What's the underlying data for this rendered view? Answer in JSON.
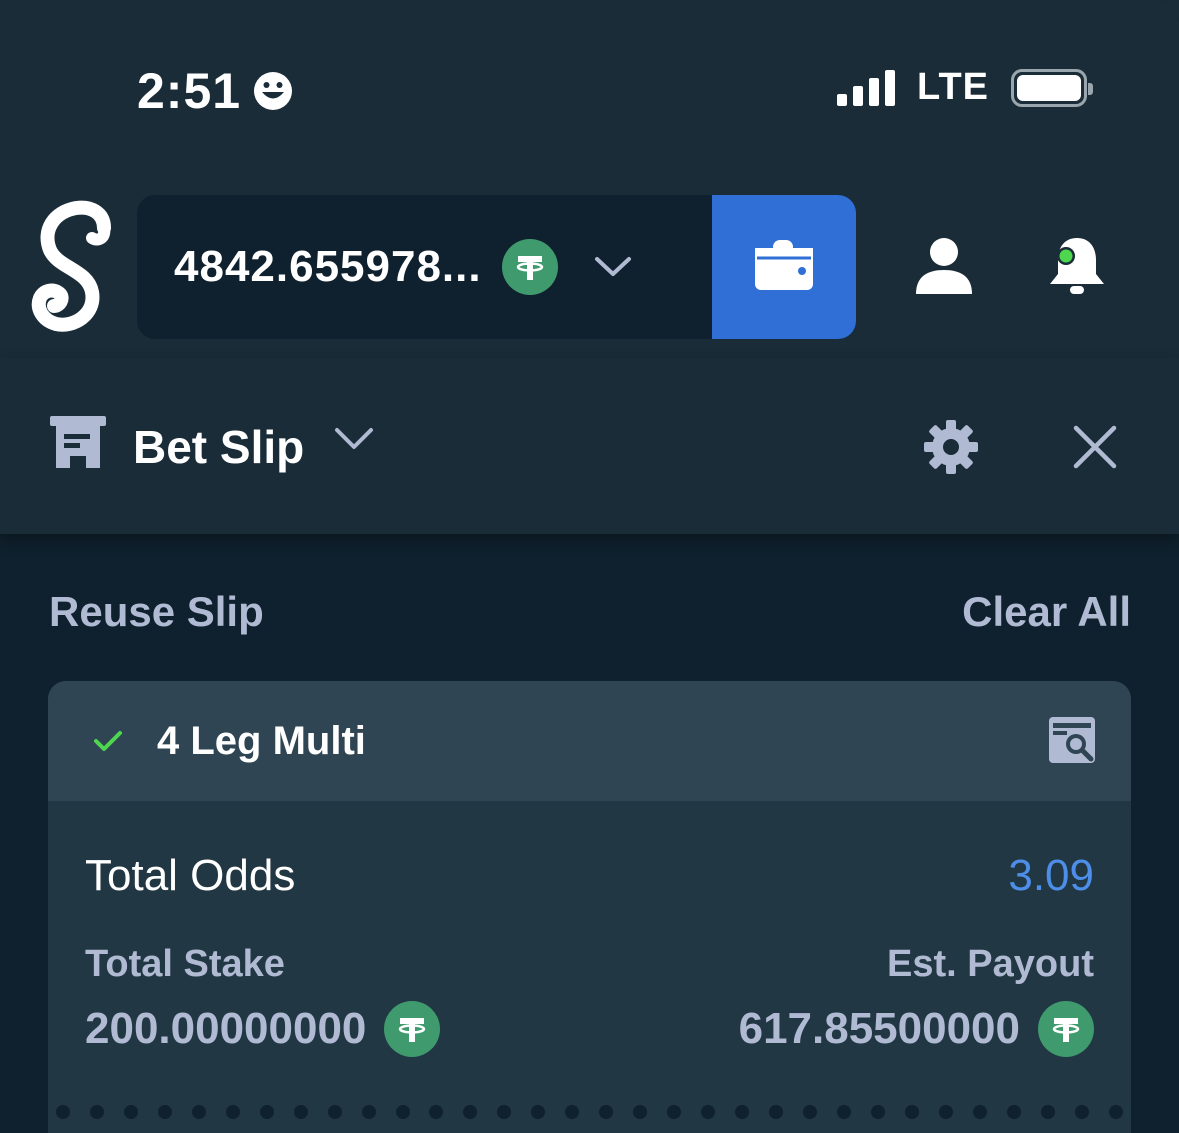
{
  "status_bar": {
    "time": "2:51",
    "network": "LTE"
  },
  "header": {
    "logo": "S",
    "balance": "4842.655978...",
    "currency_icon": "tether-icon",
    "wallet_icon": "wallet-icon",
    "user_icon": "user-icon",
    "notifications_icon": "bell-icon"
  },
  "bet_slip": {
    "title": "Bet Slip",
    "reuse_label": "Reuse Slip",
    "clear_label": "Clear All",
    "bet": {
      "title": "4 Leg Multi",
      "total_odds_label": "Total Odds",
      "total_odds_value": "3.09",
      "total_stake_label": "Total Stake",
      "total_stake_value": "200.00000000",
      "payout_label": "Est. Payout",
      "payout_value": "617.85500000"
    }
  },
  "colors": {
    "background": "#0f212e",
    "panel": "#1a2c38",
    "card": "#213743",
    "card_header": "#2f4553",
    "accent_blue": "#2f6fd6",
    "odds_blue": "#4d8fe8",
    "tether_green": "#3f9a6e",
    "muted_text": "#b1bad3",
    "check_green": "#4fd64f"
  }
}
